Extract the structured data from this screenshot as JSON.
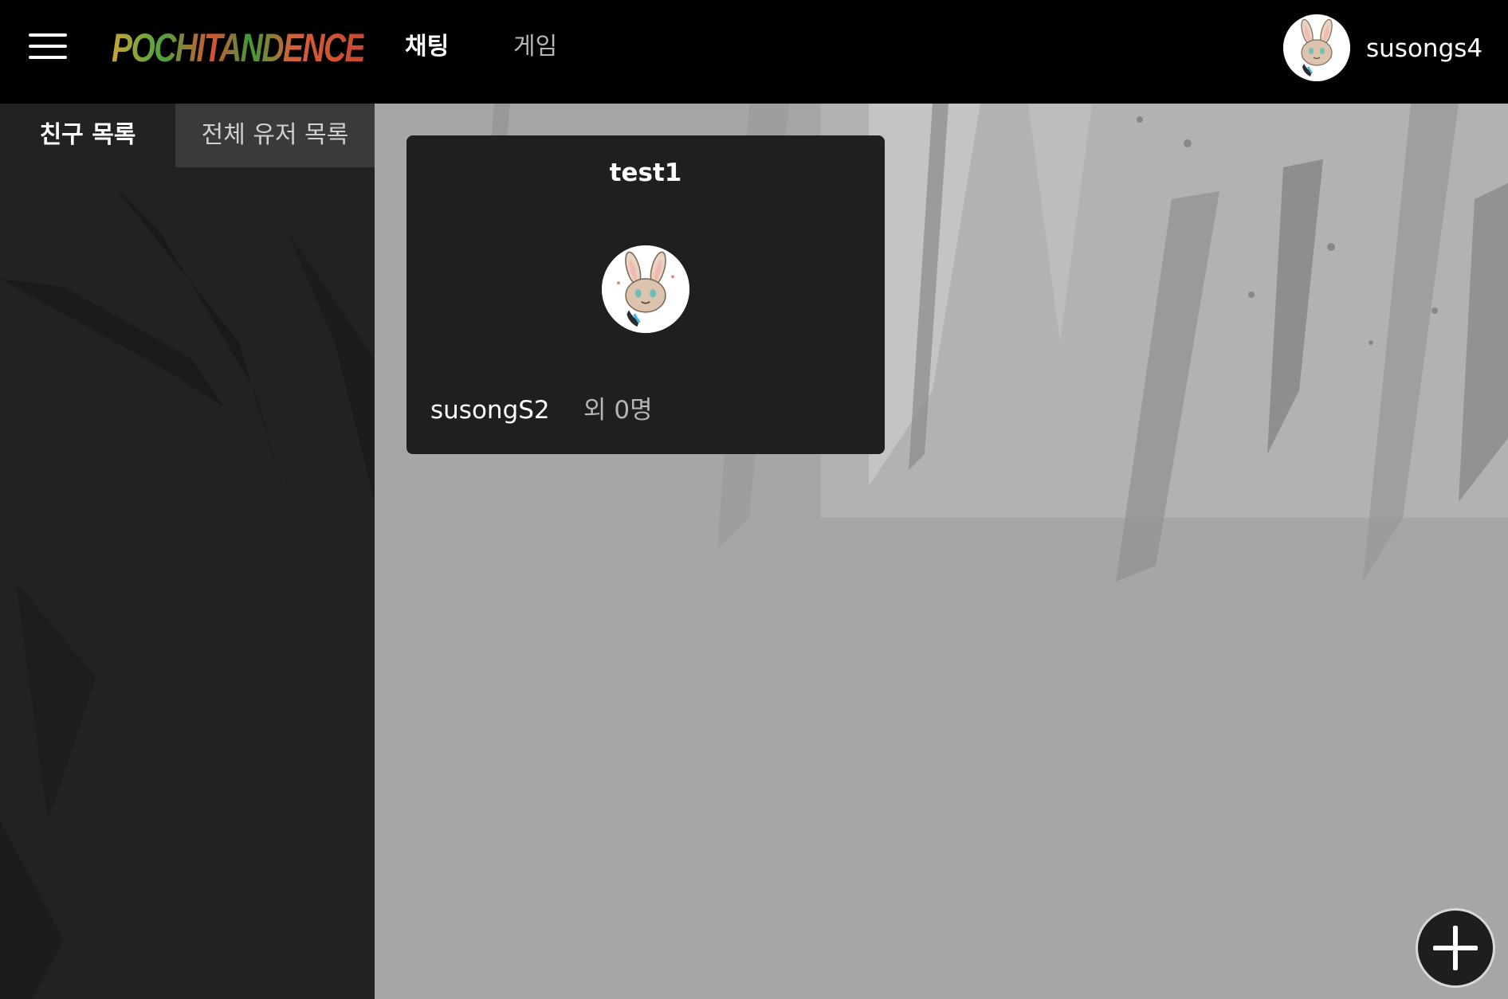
{
  "header": {
    "logo_text": "POCHITANDENCE",
    "nav_tabs": [
      {
        "label": "채팅",
        "active": true
      },
      {
        "label": "게임",
        "active": false
      }
    ],
    "username": "susongs4"
  },
  "sidebar": {
    "tabs": [
      {
        "label": "친구 목록",
        "active": true
      },
      {
        "label": "전체 유저 목록",
        "active": false
      }
    ]
  },
  "chat_rooms": [
    {
      "title": "test1",
      "owner": "susongS2",
      "others_count": "외 0명"
    }
  ],
  "colors": {
    "header_bg": "#000000",
    "sidebar_bg": "#212121",
    "main_bg": "#a8a8a8",
    "card_bg": "#1f1f1f",
    "accent_text": "#ffffff",
    "muted_text": "#b5b5b5"
  },
  "icons": {
    "menu": "hamburger-icon",
    "add": "plus-icon",
    "avatar": "rabbit-avatar"
  }
}
